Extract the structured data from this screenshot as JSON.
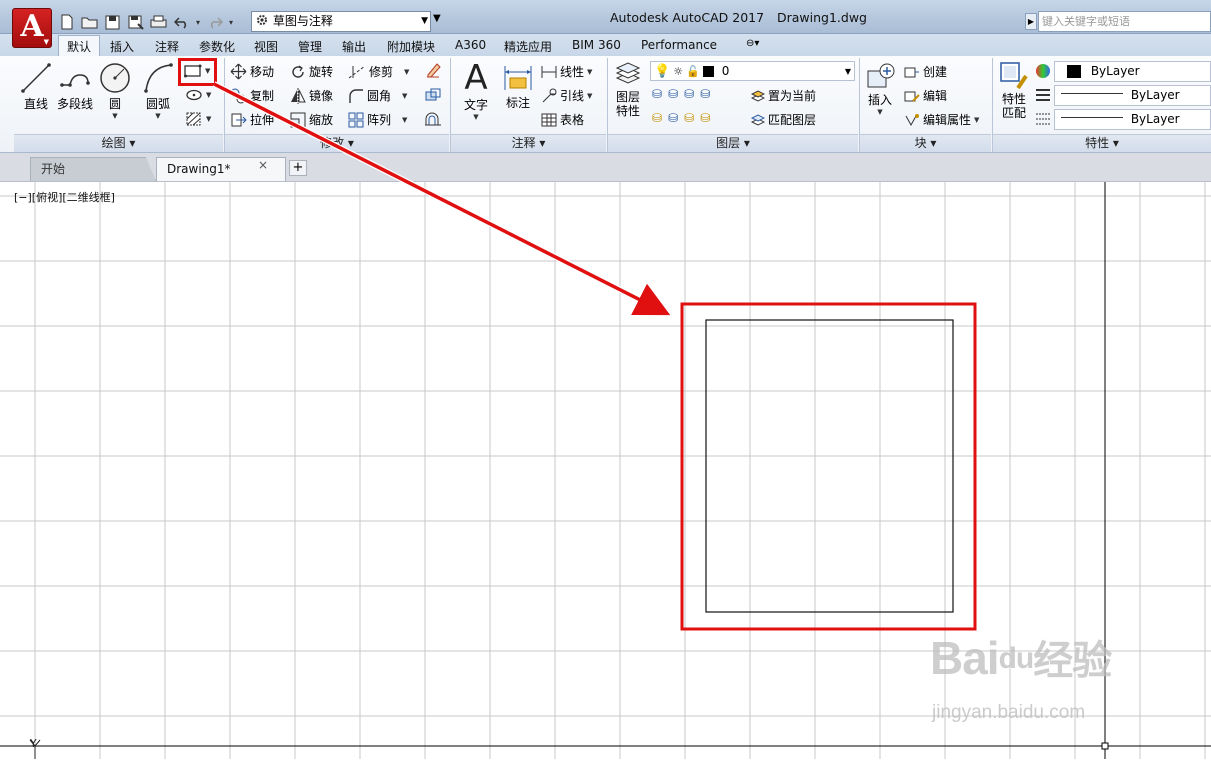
{
  "app_button": {
    "letter": "A"
  },
  "workspace_selector": {
    "value": "草图与注释"
  },
  "title": {
    "app": "Autodesk AutoCAD 2017",
    "document": "Drawing1.dwg"
  },
  "search": {
    "placeholder": "键入关键字或短语"
  },
  "ribbon_tabs": [
    "默认",
    "插入",
    "注释",
    "参数化",
    "视图",
    "管理",
    "输出",
    "附加模块",
    "A360",
    "精选应用",
    "BIM 360",
    "Performance"
  ],
  "draw_panel": {
    "title": "绘图 ▾",
    "tools": {
      "line": "直线",
      "polyline": "多段线",
      "circle": "圆",
      "arc": "圆弧"
    }
  },
  "modify_panel": {
    "title": "修改 ▾",
    "tools": {
      "move": "移动",
      "rotate": "旋转",
      "trim": "修剪",
      "copy": "复制",
      "mirror": "镜像",
      "fillet": "圆角",
      "stretch": "拉伸",
      "scale": "缩放",
      "array": "阵列"
    }
  },
  "annotation_panel": {
    "title": "注释 ▾",
    "tools": {
      "text": "文字",
      "dimension": "标注",
      "linear": "线性",
      "leader": "引线",
      "table": "表格"
    }
  },
  "layers_panel": {
    "title": "图层 ▾",
    "layer_properties": "图层\n特性",
    "current_layer": "0",
    "set_current": "置为当前",
    "match_layer": "匹配图层"
  },
  "block_panel": {
    "title": "块 ▾",
    "tools": {
      "insert": "插入",
      "create": "创建",
      "edit": "编辑",
      "edit_attributes": "编辑属性"
    }
  },
  "properties_panel": {
    "title": "特性 ▾",
    "match_properties": "特性\n匹配",
    "color": "ByLayer",
    "linetype": "ByLayer",
    "lineweight": "ByLayer"
  },
  "file_tabs": {
    "start": "开始",
    "drawing": "Drawing1*",
    "close": "×",
    "add": "+"
  },
  "viewport_label": "[−][俯视][二维线框]",
  "ucs": {
    "y_label": "Y"
  },
  "watermark": {
    "brand": "Bai",
    "paw": "du",
    "cn": "经验",
    "url": "jingyan.baidu.com"
  },
  "colors": {
    "highlight": "#e01010",
    "app_red": "#c41616",
    "grid": "#c8c8c8"
  }
}
